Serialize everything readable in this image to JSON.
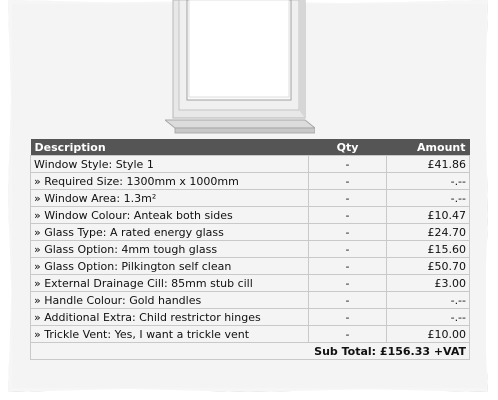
{
  "table": {
    "headers": {
      "description": "Description",
      "qty": "Qty",
      "amount": "Amount"
    },
    "rows": [
      {
        "description": "Window Style: Style 1",
        "qty": "-",
        "amount": "£41.86",
        "sub": false
      },
      {
        "description": "» Required Size: 1300mm x 1000mm",
        "qty": "-",
        "amount": "-.--",
        "sub": true
      },
      {
        "description": "» Window Area: 1.3m²",
        "qty": "-",
        "amount": "-.--",
        "sub": true
      },
      {
        "description": "» Window Colour: Anteak both sides",
        "qty": "-",
        "amount": "£10.47",
        "sub": true
      },
      {
        "description": "» Glass Type: A rated energy glass",
        "qty": "-",
        "amount": "£24.70",
        "sub": true
      },
      {
        "description": "» Glass Option: 4mm tough glass",
        "qty": "-",
        "amount": "£15.60",
        "sub": true
      },
      {
        "description": "» Glass Option: Pilkington self clean",
        "qty": "-",
        "amount": "£50.70",
        "sub": true
      },
      {
        "description": "» External Drainage Cill: 85mm stub cill",
        "qty": "-",
        "amount": "£3.00",
        "sub": true
      },
      {
        "description": "» Handle Colour: Gold handles",
        "qty": "-",
        "amount": "-.--",
        "sub": true
      },
      {
        "description": "» Additional Extra: Child restrictor hinges",
        "qty": "-",
        "amount": "-.--",
        "sub": true
      },
      {
        "description": "» Trickle Vent: Yes, I want a trickle vent",
        "qty": "-",
        "amount": "£10.00",
        "sub": true
      }
    ],
    "subtotal": "Sub Total: £156.33 +VAT"
  },
  "colors": {
    "header_bg": "#555555",
    "paper": "#f4f4f4",
    "border": "#c9c9c9"
  },
  "image": {
    "icon": "window-icon"
  }
}
